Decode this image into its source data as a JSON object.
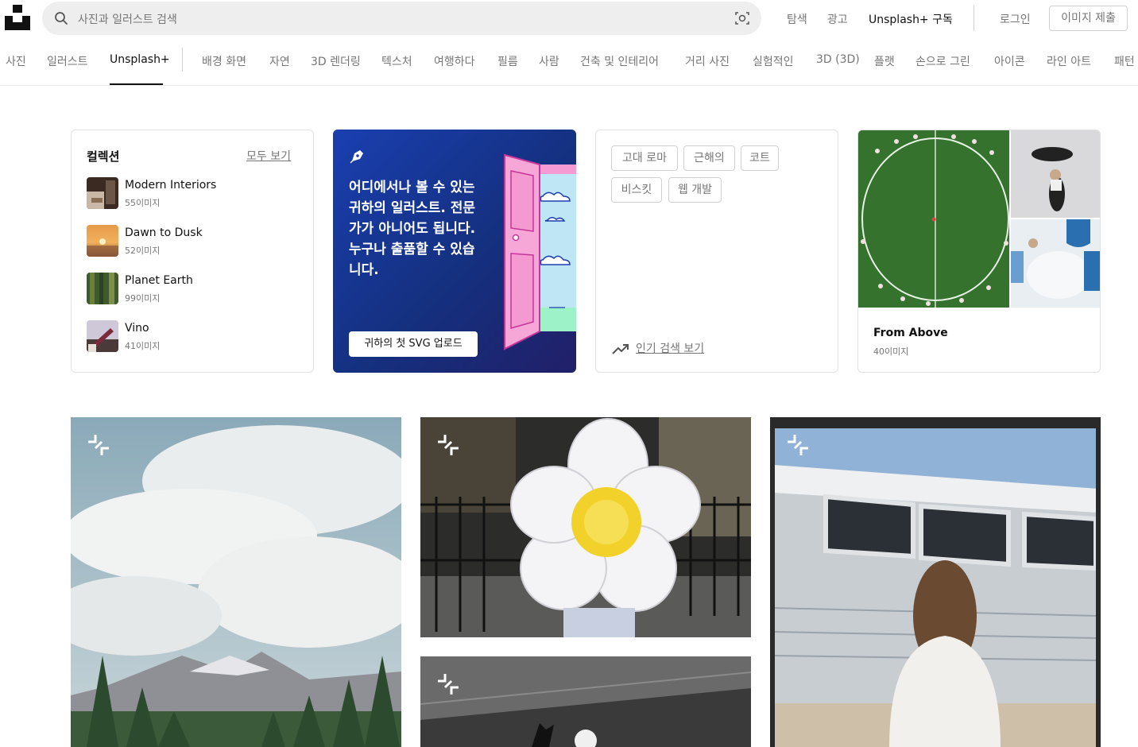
{
  "header": {
    "search_placeholder": "사진과 일러스트 검색",
    "nav": {
      "explore": "탐색",
      "ads": "광고",
      "plus_subscribe": "Unsplash+ 구독",
      "login": "로그인",
      "submit": "이미지 제출"
    }
  },
  "categories": {
    "primary": [
      "사진",
      "일러스트",
      "Unsplash+"
    ],
    "topics": [
      "배경 화면",
      "자연",
      "3D 렌더링",
      "텍스처",
      "여행하다",
      "필름",
      "사람",
      "건축 및 인테리어",
      "거리 사진",
      "실험적인",
      "3D (3D)",
      "플랫",
      "손으로 그린",
      "아이콘",
      "라인 아트",
      "패턴"
    ]
  },
  "collections": {
    "title": "컬렉션",
    "view_all": "모두 보기",
    "items": [
      {
        "name": "Modern Interiors",
        "count": "55이미지"
      },
      {
        "name": "Dawn to Dusk",
        "count": "52이미지"
      },
      {
        "name": "Planet Earth",
        "count": "99이미지"
      },
      {
        "name": "Vino",
        "count": "41이미지"
      }
    ]
  },
  "promo": {
    "text": "어디에서나 볼 수 있는 귀하의 일러스트. 전문가가 아니어도 됩니다. 누구나 출품할 수 있습니다.",
    "button": "귀하의 첫 SVG 업로드"
  },
  "trending": {
    "tags": [
      "고대 로마",
      "근해의",
      "코트",
      "비스킷",
      "웹 개발"
    ],
    "link": "인기 검색 보기"
  },
  "featured": {
    "title": "From Above",
    "count": "40이미지"
  },
  "colors": {
    "promo_blue": "#1a3fb0",
    "muted_text": "#767676",
    "border": "#d1d1d1"
  }
}
